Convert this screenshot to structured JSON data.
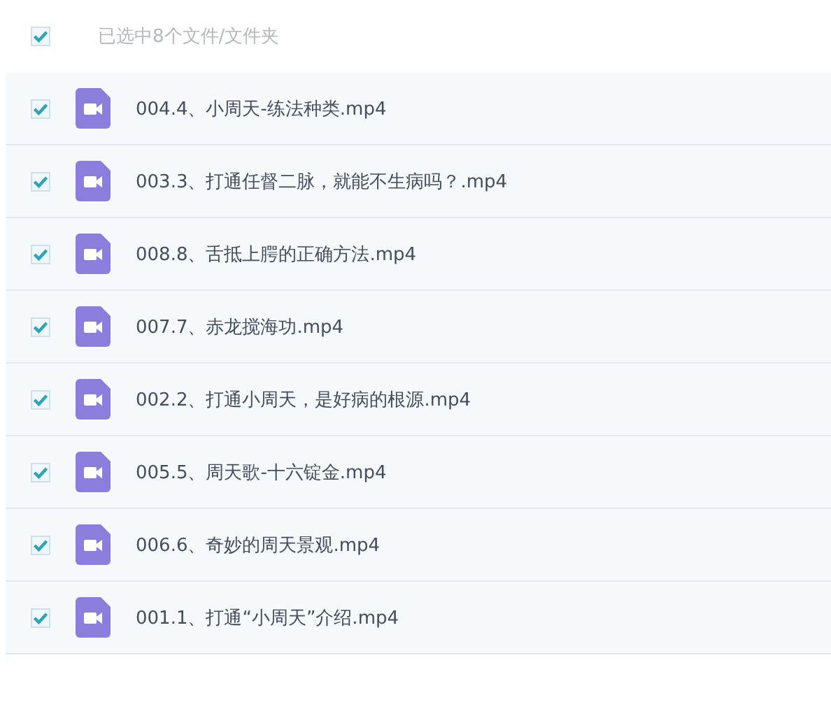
{
  "header": {
    "checked": true,
    "label": "已选中8个文件/文件夹"
  },
  "files": [
    {
      "name": "004.4、小周天-练法种类.mp4",
      "checked": true,
      "kind": "video"
    },
    {
      "name": "003.3、打通任督二脉，就能不生病吗？.mp4",
      "checked": true,
      "kind": "video"
    },
    {
      "name": "008.8、舌抵上腭的正确方法.mp4",
      "checked": true,
      "kind": "video"
    },
    {
      "name": "007.7、赤龙搅海功.mp4",
      "checked": true,
      "kind": "video"
    },
    {
      "name": "002.2、打通小周天，是好病的根源.mp4",
      "checked": true,
      "kind": "video"
    },
    {
      "name": "005.5、周天歌-十六锭金.mp4",
      "checked": true,
      "kind": "video"
    },
    {
      "name": "006.6、奇妙的周天景观.mp4",
      "checked": true,
      "kind": "video"
    },
    {
      "name": "001.1、打通“小周天”介绍.mp4",
      "checked": true,
      "kind": "video"
    }
  ]
}
